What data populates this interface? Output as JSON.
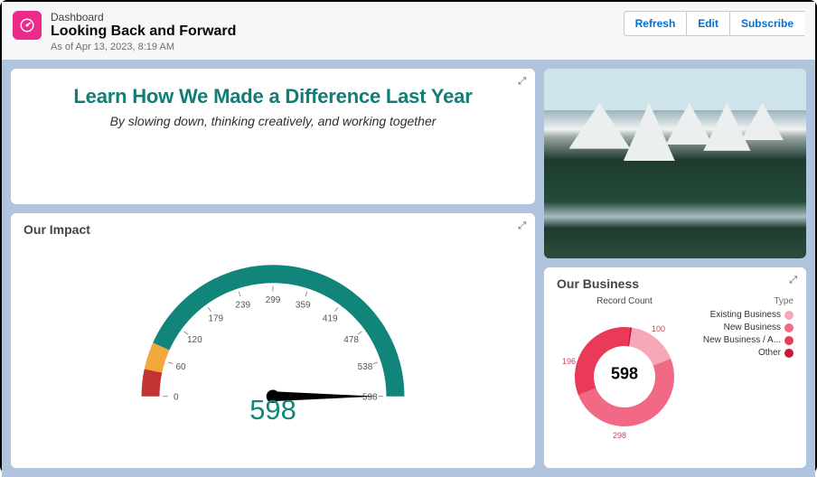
{
  "header": {
    "eyebrow": "Dashboard",
    "title": "Looking Back and Forward",
    "as_of": "As of Apr 13, 2023, 8:19 AM",
    "buttons": {
      "refresh": "Refresh",
      "edit": "Edit",
      "subscribe": "Subscribe"
    }
  },
  "hero": {
    "title": "Learn How We Made a Difference Last Year",
    "subtitle": "By slowing down, thinking creatively, and working together"
  },
  "impact": {
    "title": "Our Impact"
  },
  "business": {
    "title": "Our Business",
    "subtitle": "Record Count",
    "center": "598",
    "legend_title": "Type",
    "legend": [
      {
        "label": "Existing Business",
        "color": "#f7a8b8"
      },
      {
        "label": "New Business",
        "color": "#f16985"
      },
      {
        "label": "New Business / A...",
        "color": "#ea3a5a"
      },
      {
        "label": "Other",
        "color": "#c9163a"
      }
    ],
    "seg_labels": {
      "a": "100",
      "b": "298",
      "c": "196"
    }
  },
  "chart_data": [
    {
      "type": "gauge",
      "title": "Our Impact",
      "min": 0,
      "max": 598,
      "value": 598,
      "ticks": [
        0,
        60,
        120,
        179,
        239,
        299,
        359,
        419,
        478,
        538,
        598
      ],
      "segments": [
        {
          "from": 0,
          "to": 40,
          "color": "#c23434"
        },
        {
          "from": 40,
          "to": 80,
          "color": "#f0a93a"
        },
        {
          "from": 80,
          "to": 598,
          "color": "#11857a"
        }
      ],
      "display_value": "598"
    },
    {
      "type": "donut",
      "title": "Our Business",
      "subtitle": "Record Count",
      "total": 598,
      "series": [
        {
          "name": "Existing Business",
          "value": 100,
          "color": "#f7a8b8"
        },
        {
          "name": "New Business",
          "value": 298,
          "color": "#f16985"
        },
        {
          "name": "New Business / A...",
          "value": 196,
          "color": "#ea3a5a"
        },
        {
          "name": "Other",
          "value": 4,
          "color": "#c9163a"
        }
      ]
    }
  ]
}
